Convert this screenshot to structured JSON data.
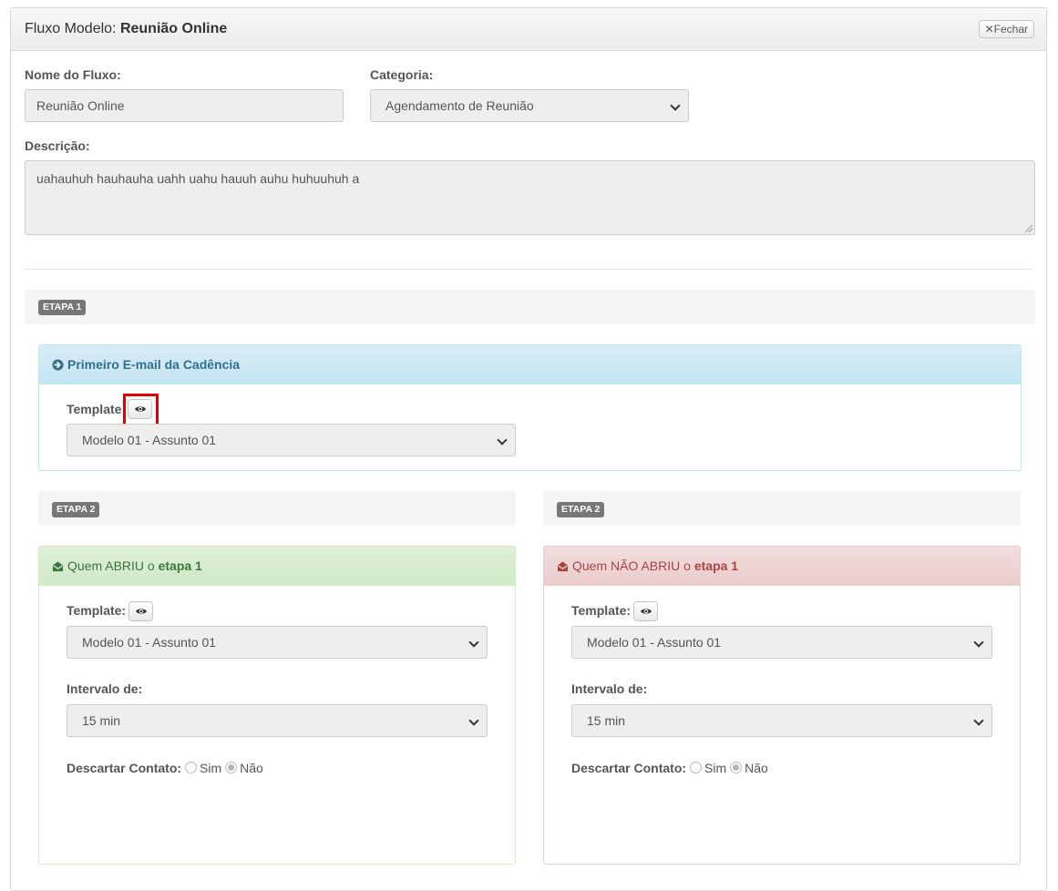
{
  "header": {
    "title_prefix": "Fluxo Modelo:",
    "title_name": "Reunião Online",
    "close_label": "Fechar"
  },
  "form": {
    "nome_label": "Nome do Fluxo:",
    "nome_value": "Reunião Online",
    "categoria_label": "Categoria:",
    "categoria_value": "Agendamento de Reunião",
    "descricao_label": "Descrição:",
    "descricao_value": "uahauhuh hauhauha uahh uahu hauuh auhu huhuuhuh a"
  },
  "etapa1": {
    "badge": "ETAPA 1",
    "panel_title": "Primeiro E-mail da Cadência",
    "template_label": "Template",
    "template_value": "Modelo 01 - Assunto 01"
  },
  "etapa2_left": {
    "badge": "ETAPA 2",
    "title_pre": "Quem ABRIU o",
    "title_bold": "etapa 1",
    "template_label": "Template:",
    "template_value": "Modelo 01 - Assunto 01",
    "intervalo_label": "Intervalo de:",
    "intervalo_value": "15 min",
    "descartar_label": "Descartar Contato:",
    "sim_label": "Sim",
    "nao_label": "Não"
  },
  "etapa2_right": {
    "badge": "ETAPA 2",
    "title_pre": "Quem NÃO ABRIU o",
    "title_bold": "etapa 1",
    "template_label": "Template:",
    "template_value": "Modelo 01 - Assunto 01",
    "intervalo_label": "Intervalo de:",
    "intervalo_value": "15 min",
    "descartar_label": "Descartar Contato:",
    "sim_label": "Sim",
    "nao_label": "Não"
  },
  "colors": {
    "info_bg": "#d9edf7",
    "info_text": "#31708f",
    "success_bg": "#dff0d8",
    "success_text": "#3c763d",
    "danger_bg": "#f2dede",
    "danger_text": "#a94442",
    "highlight": "#e00000"
  }
}
